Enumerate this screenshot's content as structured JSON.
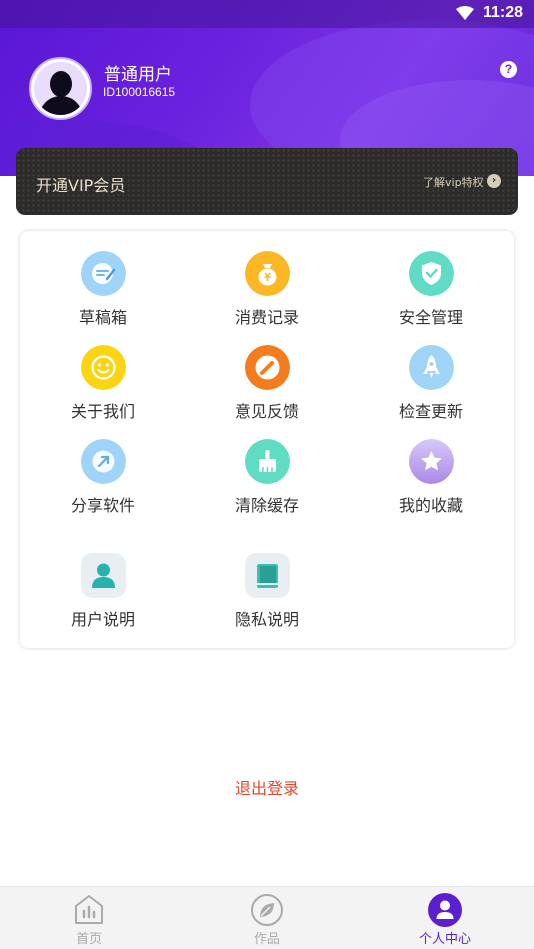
{
  "status_bar": {
    "time": "11:28",
    "wifi_icon": "wifi-icon"
  },
  "profile": {
    "name": "普通用户",
    "id": "ID100016615",
    "help_glyph": "?"
  },
  "vip": {
    "title": "开通VIP会员",
    "more": "了解vip特权",
    "arrow_glyph": "›"
  },
  "menu": {
    "items": [
      {
        "label": "草稿箱",
        "icon": "draft-icon",
        "color": "#9fd3f7"
      },
      {
        "label": "消费记录",
        "icon": "money-bag-icon",
        "color": "#fbb724"
      },
      {
        "label": "安全管理",
        "icon": "shield-check-icon",
        "color": "#5fdcc3"
      },
      {
        "label": "关于我们",
        "icon": "smile-icon",
        "color": "#fcd512"
      },
      {
        "label": "意见反馈",
        "icon": "pencil-icon",
        "color": "#f47c1c"
      },
      {
        "label": "检查更新",
        "icon": "rocket-icon",
        "color": "#9fd3f7"
      },
      {
        "label": "分享软件",
        "icon": "share-arrow-icon",
        "color": "#9fd3f7"
      },
      {
        "label": "清除缓存",
        "icon": "broom-icon",
        "color": "#5fdcc3"
      },
      {
        "label": "我的收藏",
        "icon": "star-icon",
        "color": "#c1a9f0"
      },
      {
        "label": "用户说明",
        "icon": "user-icon",
        "color": "#27b3ad"
      },
      {
        "label": "隐私说明",
        "icon": "book-icon",
        "color": "#3abfb1"
      }
    ]
  },
  "logout_label": "退出登录",
  "tabs": [
    {
      "label": "首页",
      "icon": "home-chart-icon",
      "active": false
    },
    {
      "label": "作品",
      "icon": "leaf-icon",
      "active": false
    },
    {
      "label": "个人中心",
      "icon": "person-icon",
      "active": true
    }
  ],
  "colors": {
    "accent": "#5b1fd0",
    "logout": "#e0492e",
    "vip_bg": "#2d2b2a",
    "vip_text": "#e8ddc7"
  }
}
